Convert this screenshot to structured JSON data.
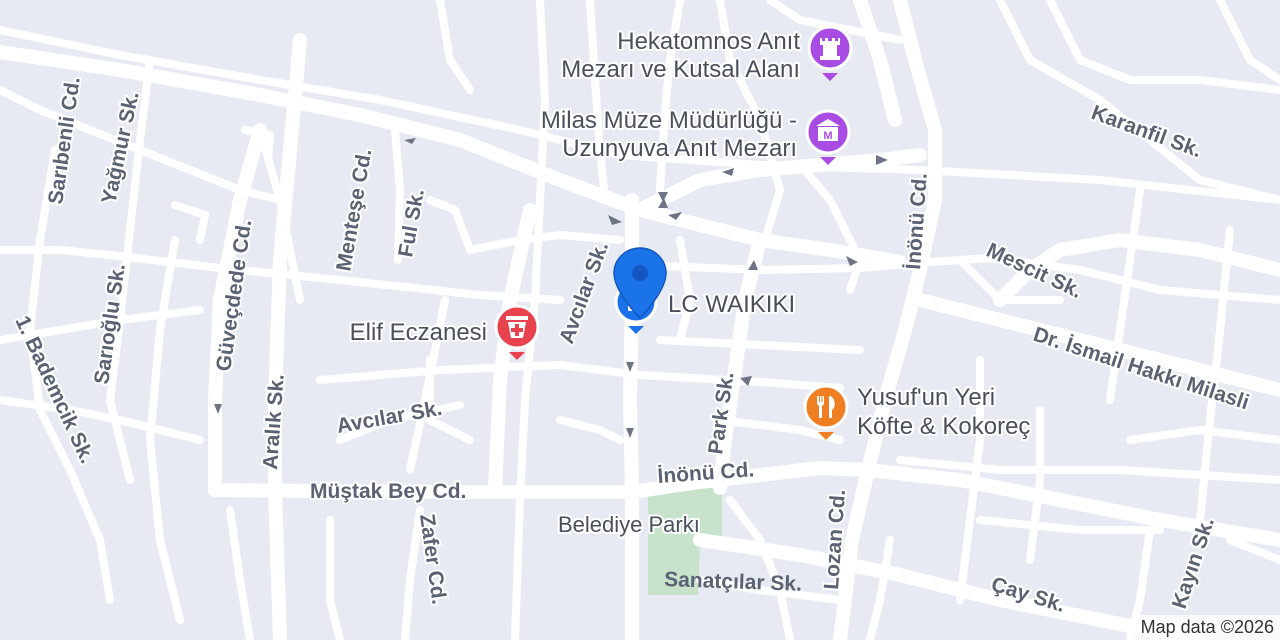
{
  "map": {
    "attribution": "Map data ©2026",
    "colors": {
      "background": "#e8eaf3",
      "road": "#ffffff",
      "park": "#c8e3cc",
      "marker": "#1a73e8",
      "pharmacy": "#e8424f",
      "museum": "#a94ce3",
      "restaurant": "#f07e22"
    },
    "streets": [
      "Sarıbenli Cd.",
      "Yağmur Sk.",
      "Sarıoğlu Sk.",
      "1. Bademcik Sk.",
      "Güveçdede Cd.",
      "Menteşe Cd.",
      "Ful Sk.",
      "Aralık Sk.",
      "Avcılar Sk.",
      "Avcılar Sk.",
      "İnönü Cd.",
      "Mescit Sk.",
      "Karanfil Sk.",
      "Dr. İsmail Hakkı Milasli",
      "Park Sk.",
      "Müştak Bey Cd.",
      "İnönü Cd.",
      "Zafer Cd.",
      "Sanatçılar Sk.",
      "Lozan Cd.",
      "Çay Sk.",
      "Kayın Sk."
    ],
    "pois": [
      {
        "line1": "Hekatomnos Anıt",
        "line2": "Mezarı ve Kutsal Alanı",
        "icon": "monument-icon"
      },
      {
        "line1": "Milas Müze Müdürlüğü -",
        "line2": "Uzunyuva Anıt Mezarı",
        "icon": "museum-icon"
      },
      {
        "line1": "Elif Eczanesi",
        "icon": "pharmacy-icon"
      },
      {
        "line1": "Yusuf'un Yeri",
        "line2": "Köfte & Kokoreç",
        "icon": "restaurant-icon"
      },
      {
        "line1": "LC WAIKIKI",
        "icon": "shopping-bag-icon"
      }
    ],
    "park": "Belediye Parkı",
    "marker": "location-pin-icon"
  }
}
